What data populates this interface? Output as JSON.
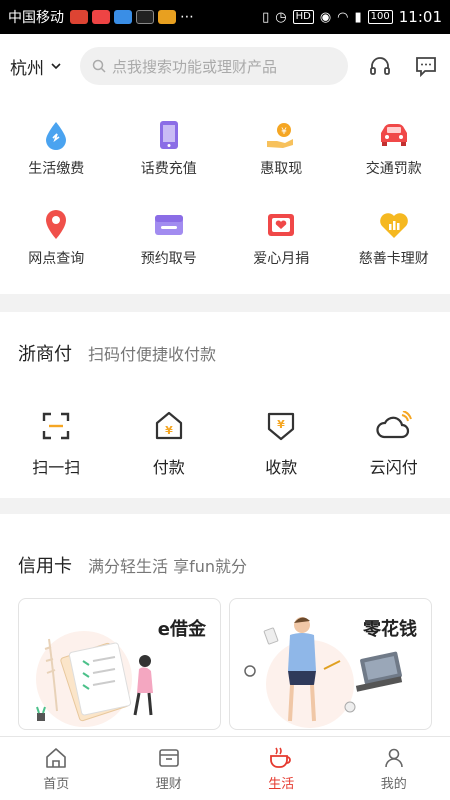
{
  "status_bar": {
    "carrier": "中国移动",
    "time": "11:01",
    "battery": "100"
  },
  "header": {
    "city": "杭州",
    "search_placeholder": "点我搜索功能或理财产品"
  },
  "services": [
    {
      "label": "生活缴费",
      "icon": "water-drop-icon",
      "color": "#4aa3f0"
    },
    {
      "label": "话费充值",
      "icon": "phone-icon",
      "color": "#8b6de6"
    },
    {
      "label": "惠取现",
      "icon": "cash-hand-icon",
      "color": "#f5a623"
    },
    {
      "label": "交通罚款",
      "icon": "car-icon",
      "color": "#f04848"
    },
    {
      "label": "网点查询",
      "icon": "location-pin-icon",
      "color": "#f0504a"
    },
    {
      "label": "预约取号",
      "icon": "ticket-icon",
      "color": "#8b6de6"
    },
    {
      "label": "爱心月捐",
      "icon": "heart-card-icon",
      "color": "#f04848"
    },
    {
      "label": "慈善卡理财",
      "icon": "chart-heart-icon",
      "color": "#f5b820"
    }
  ],
  "zheshangfu": {
    "title": "浙商付",
    "subtitle": "扫码付便捷收付款",
    "actions": [
      {
        "label": "扫一扫",
        "icon": "scan-icon"
      },
      {
        "label": "付款",
        "icon": "pay-icon"
      },
      {
        "label": "收款",
        "icon": "receive-icon"
      },
      {
        "label": "云闪付",
        "icon": "cloud-pay-icon"
      }
    ]
  },
  "credit": {
    "title": "信用卡",
    "subtitle": "满分轻生活 享fun就分",
    "cards": [
      {
        "title": "e借金"
      },
      {
        "title": "零花钱"
      }
    ]
  },
  "bottom_nav": [
    {
      "label": "首页",
      "icon": "home-icon",
      "active": false
    },
    {
      "label": "理财",
      "icon": "wallet-icon",
      "active": false
    },
    {
      "label": "生活",
      "icon": "coffee-cup-icon",
      "active": true
    },
    {
      "label": "我的",
      "icon": "user-icon",
      "active": false
    }
  ],
  "colors": {
    "accent": "#e53a2f",
    "background": "#f2f2f2"
  }
}
